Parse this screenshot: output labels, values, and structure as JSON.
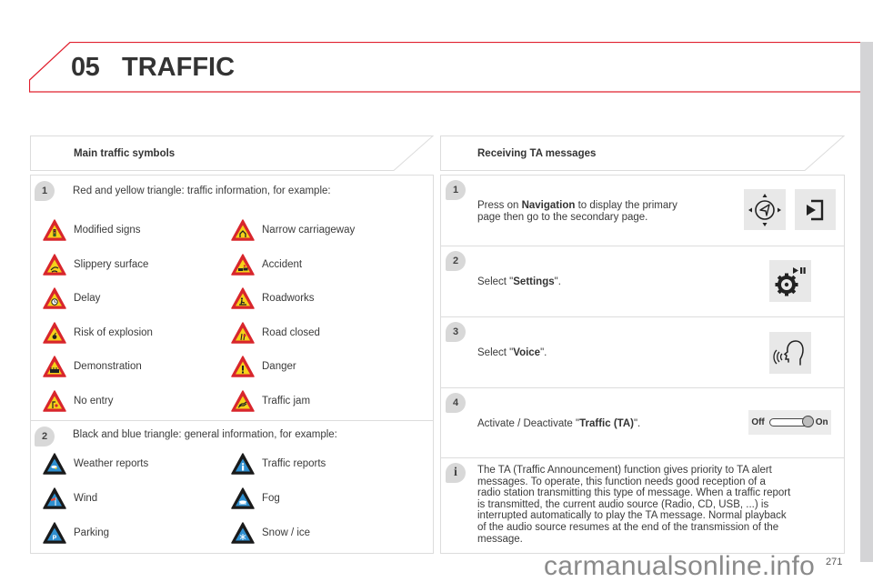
{
  "header": {
    "chapter_number": "05",
    "chapter_title": "TRAFFIC",
    "accent_color": "#e0202e"
  },
  "left": {
    "section_title": "Main traffic symbols",
    "group1": {
      "badge": "1",
      "intro": "Red and yellow triangle: traffic information, for example:",
      "style": "red-yellow",
      "symbols": [
        {
          "label": "Modified signs",
          "icon": "traffic-light-icon"
        },
        {
          "label": "Narrow carriageway",
          "icon": "narrow-road-icon"
        },
        {
          "label": "Slippery surface",
          "icon": "slippery-car-icon"
        },
        {
          "label": "Accident",
          "icon": "accident-icon"
        },
        {
          "label": "Delay",
          "icon": "clock-icon"
        },
        {
          "label": "Roadworks",
          "icon": "roadworks-icon"
        },
        {
          "label": "Risk of explosion",
          "icon": "explosion-icon"
        },
        {
          "label": "Road closed",
          "icon": "road-closed-icon"
        },
        {
          "label": "Demonstration",
          "icon": "demonstration-icon"
        },
        {
          "label": "Danger",
          "icon": "exclamation-icon"
        },
        {
          "label": "No entry",
          "icon": "no-entry-icon"
        },
        {
          "label": "Traffic jam",
          "icon": "traffic-jam-icon"
        }
      ]
    },
    "group2": {
      "badge": "2",
      "intro": "Black and blue triangle: general information, for example:",
      "style": "black-blue",
      "symbols": [
        {
          "label": "Weather reports",
          "icon": "weather-icon"
        },
        {
          "label": "Traffic reports",
          "icon": "info-icon"
        },
        {
          "label": "Wind",
          "icon": "windsock-icon"
        },
        {
          "label": "Fog",
          "icon": "fog-icon"
        },
        {
          "label": "Parking",
          "icon": "parking-icon"
        },
        {
          "label": "Snow / ice",
          "icon": "snowflake-icon"
        }
      ]
    }
  },
  "right": {
    "section_title": "Receiving TA messages",
    "steps": [
      {
        "badge": "1",
        "pre": "Press on ",
        "bold": "Navigation",
        "post": " to display the primary",
        "line2": "page then go to the secondary page."
      },
      {
        "badge": "2",
        "pre": "Select \"",
        "bold": "Settings",
        "post": "\"."
      },
      {
        "badge": "3",
        "pre": "Select \"",
        "bold": "Voice",
        "post": "\"."
      },
      {
        "badge": "4",
        "pre": "Activate / Deactivate \"",
        "bold": "Traffic (TA)",
        "post": "\"."
      }
    ],
    "toggle": {
      "off_label": "Off",
      "on_label": "On",
      "state": "on"
    },
    "info": {
      "badge": "i",
      "lines": [
        "The TA (Traffic Announcement) function gives priority to TA alert",
        "messages. To operate, this function needs good reception of a",
        "radio station transmitting this type of message. When a traffic report",
        "is transmitted, the current audio source (Radio, CD, USB, ...) is",
        "interrupted automatically to play the TA message. Normal playback",
        "of the audio source resumes at the end of the transmission of the",
        "message."
      ]
    }
  },
  "footer": {
    "page_number": "271",
    "watermark": "carmanualsonline.info"
  }
}
